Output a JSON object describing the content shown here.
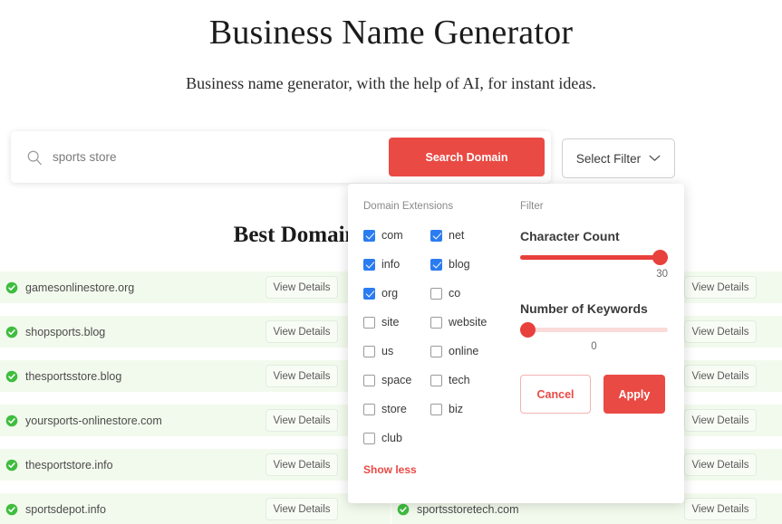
{
  "header": {
    "title": "Business Name Generator",
    "subtitle": "Business name generator, with the help of AI, for instant ideas."
  },
  "search": {
    "value": "sports store",
    "placeholder": "sports store",
    "button_label": "Search Domain",
    "filter_button_label": "Select Filter"
  },
  "results": {
    "heading": "Best Domains for",
    "view_details_label": "View Details",
    "left_column": [
      {
        "domain": "gamesonlinestore.org"
      },
      {
        "domain": "shopsports.blog"
      },
      {
        "domain": "thesportsstore.blog"
      },
      {
        "domain": "yoursports-onlinestore.com"
      },
      {
        "domain": "thesportstore.info"
      },
      {
        "domain": "sportsdepot.info"
      }
    ],
    "right_column": [
      {
        "domain": ""
      },
      {
        "domain": ""
      },
      {
        "domain": ""
      },
      {
        "domain": ""
      },
      {
        "domain": ""
      },
      {
        "domain": "sportsstoretech.com"
      }
    ]
  },
  "filter_panel": {
    "extensions_caption": "Domain Extensions",
    "filter_caption": "Filter",
    "extensions": [
      {
        "label": "com",
        "checked": true
      },
      {
        "label": "net",
        "checked": true
      },
      {
        "label": "info",
        "checked": true
      },
      {
        "label": "blog",
        "checked": true
      },
      {
        "label": "org",
        "checked": true
      },
      {
        "label": "co",
        "checked": false
      },
      {
        "label": "site",
        "checked": false
      },
      {
        "label": "website",
        "checked": false
      },
      {
        "label": "us",
        "checked": false
      },
      {
        "label": "online",
        "checked": false
      },
      {
        "label": "space",
        "checked": false
      },
      {
        "label": "tech",
        "checked": false
      },
      {
        "label": "store",
        "checked": false
      },
      {
        "label": "biz",
        "checked": false
      },
      {
        "label": "club",
        "checked": false
      }
    ],
    "show_less_label": "Show less",
    "character_count": {
      "label": "Character Count",
      "value": "30",
      "percent": 100
    },
    "number_of_keywords": {
      "label": "Number of Keywords",
      "value": "0",
      "percent": 0
    },
    "cancel_label": "Cancel",
    "apply_label": "Apply"
  },
  "colors": {
    "accent_red": "#ea4a44",
    "checkbox_blue": "#2b7cf1",
    "row_green": "#f2faed",
    "check_green": "#3fbd3f"
  }
}
